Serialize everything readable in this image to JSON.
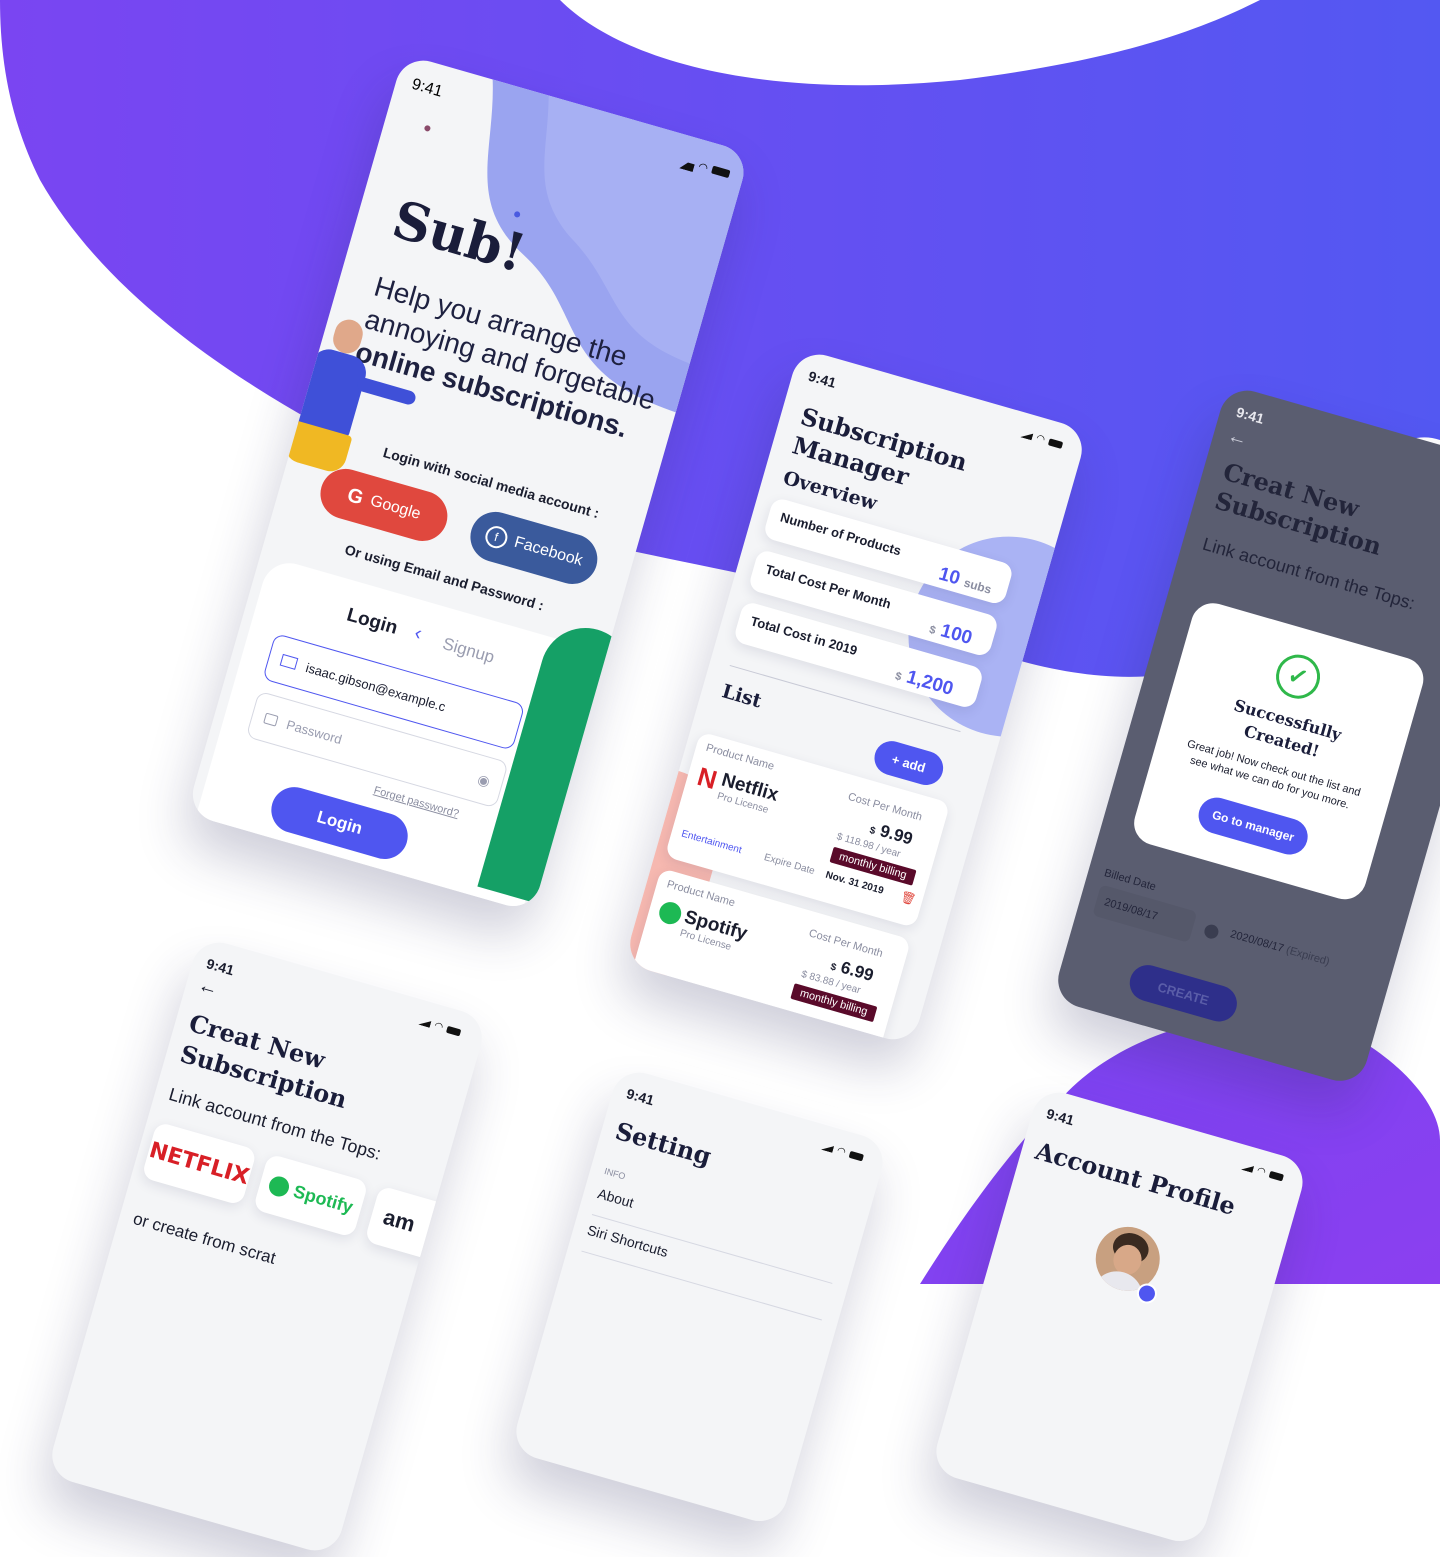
{
  "colors": {
    "purple": "#6a4cf0",
    "indigo": "#4f56f0",
    "google": "#e0483e",
    "facebook": "#3a5a9c",
    "success": "#2fb84a",
    "netflix": "#d81f26",
    "spotify": "#1db954",
    "amazon_orange": "#f49b1a"
  },
  "status": {
    "time": "9:41"
  },
  "welcome": {
    "logo": "Sub!",
    "tagline_line1": "Help you arrange the",
    "tagline_line2": "annoying and forgetable",
    "tagline_bold": "online subscriptions.",
    "social_label": "Login with social media account :",
    "google_label": "Google",
    "facebook_label": "Facebook",
    "email_label": "Or using Email and Password :",
    "tab_login": "Login",
    "tab_signup": "Signup",
    "email_value": "isaac.gibson@example.c",
    "password_placeholder": "Password",
    "forgot": "Forget password?",
    "login_button": "Login"
  },
  "manager": {
    "title_line1": "Subscription",
    "title_line2": "Manager",
    "overview": "Overview",
    "stats": [
      {
        "label": "Number of Products",
        "value": "10",
        "unit": "subs"
      },
      {
        "label": "Total Cost Per Month",
        "currency": "$",
        "value": "100"
      },
      {
        "label": "Total Cost in 2019",
        "currency": "$",
        "value": "1,200"
      }
    ],
    "list_title": "List",
    "add_button": "+ add",
    "items": [
      {
        "product_label": "Product Name",
        "name": "Netflix",
        "plan": "Pro License",
        "cost_label": "Cost Per Month",
        "currency": "$",
        "price": "9.99",
        "yearly": "$ 118.98 / year",
        "billing": "monthly billing",
        "category": "Entertainment",
        "expire_label": "Expire Date",
        "expire_value": "Nov. 31 2019"
      },
      {
        "product_label": "Product Name",
        "name": "Spotify",
        "plan": "Pro License",
        "cost_label": "Cost Per Month",
        "currency": "$",
        "price": "6.99",
        "yearly": "$ 83.88 / year",
        "billing": "monthly billing"
      }
    ]
  },
  "success_screen": {
    "back": "←",
    "title_line1": "Creat New",
    "title_line2": "Subscription",
    "link_label": "Link account from the Tops:",
    "modal_title_line1": "Successfully",
    "modal_title_line2": "Created!",
    "modal_text_line1": "Great job! Now check out the list and",
    "modal_text_line2": "see what we can do for you more.",
    "modal_button": "Go to manager",
    "billed_label": "Billed Date",
    "billed_value": "2019/08/17",
    "expire_value": "2020/08/17",
    "expired_note": "(Expired)",
    "create_button": "CREATE"
  },
  "create_screen": {
    "back": "←",
    "title_line1": "Creat New",
    "title_line2": "Subscription",
    "link_label": "Link account from the Tops:",
    "brand_netflix": "NETFLIX",
    "brand_spotify": "Spotify",
    "brand_amazon": "am",
    "scratch_label": "or create from scrat"
  },
  "setting": {
    "title": "Setting",
    "section": "INFO",
    "items": [
      "About",
      "Siri Shortcuts"
    ]
  },
  "profile": {
    "title": "Account Profile"
  }
}
